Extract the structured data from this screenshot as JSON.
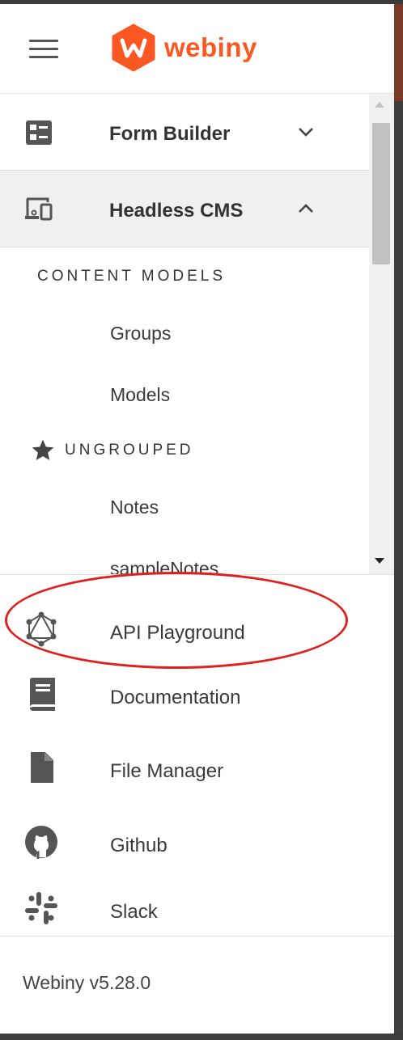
{
  "header": {
    "logo_text": "webiny"
  },
  "menu": {
    "form_builder": {
      "label": "Form Builder",
      "expanded": false
    },
    "headless_cms": {
      "label": "Headless CMS",
      "expanded": true
    }
  },
  "cms": {
    "content_models_title": "CONTENT MODELS",
    "groups_label": "Groups",
    "models_label": "Models",
    "ungrouped_title": "UNGROUPED",
    "notes_label": "Notes",
    "sample_notes_label": "sampleNotes"
  },
  "links": {
    "api_playground": "API Playground",
    "documentation": "Documentation",
    "file_manager": "File Manager",
    "github": "Github",
    "slack": "Slack"
  },
  "footer": {
    "version": "Webiny v5.28.0"
  },
  "colors": {
    "brand": "#fa5723",
    "annotation": "#e0201e"
  }
}
